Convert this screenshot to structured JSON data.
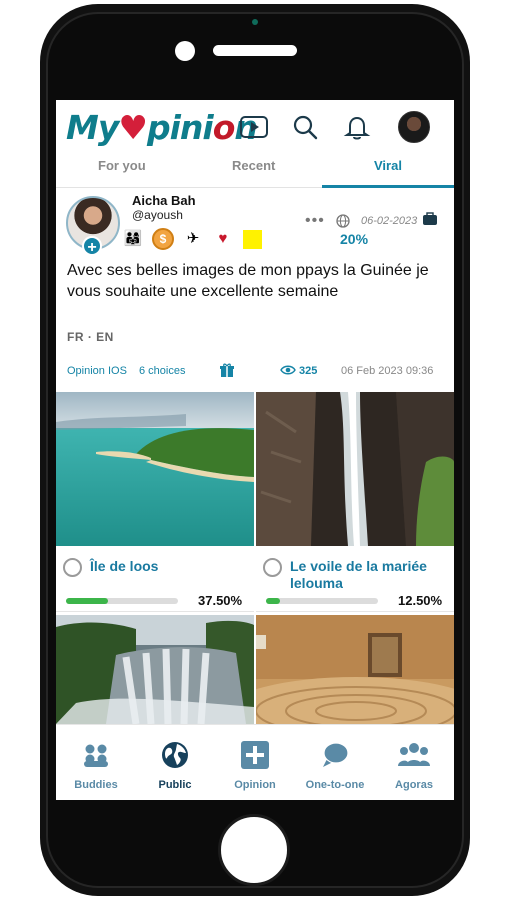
{
  "app": {
    "logo_text_left": "My",
    "logo_heart": "♥",
    "logo_text_right": "pini",
    "logo_text_end": "n",
    "colors": {
      "accent": "#1584a6",
      "brand_teal": "#0f7d8c",
      "heart_red": "#d41f3a",
      "progress_green": "#3cb54a"
    }
  },
  "header_icons": [
    "video-play-icon",
    "search-icon",
    "bell-icon",
    "user-avatar"
  ],
  "tabs": [
    {
      "label": "For you",
      "active": false
    },
    {
      "label": "Recent",
      "active": false
    },
    {
      "label": "Viral",
      "active": true
    }
  ],
  "post": {
    "author_name": "Aicha Bah",
    "author_handle": "@ayoush",
    "more": "•••",
    "date": "06-02-2023",
    "badges_percent": "20%",
    "text": "Avec ses belles images de mon ppays la Guinée je vous souhaite une excellente semaine",
    "langs": "FR  ·  EN",
    "source": "Opinion IOS",
    "choices_count": "6 choices",
    "views": "325",
    "datetime": "06 Feb 2023 09:36"
  },
  "choices": [
    {
      "label": "Île de loos",
      "percent": "37.50%",
      "fraction": 0.375,
      "selected": false
    },
    {
      "label": "Le voile de la mariée lelouma",
      "percent": "12.50%",
      "fraction": 0.125,
      "selected": false
    },
    {
      "label": "",
      "percent": "",
      "selected": false
    },
    {
      "label": "",
      "percent": "",
      "selected": false
    }
  ],
  "bottom_nav": [
    {
      "label": "Buddies",
      "icon": "buddies-icon",
      "active": false
    },
    {
      "label": "Public",
      "icon": "globe-icon",
      "active": true
    },
    {
      "label": "Opinion",
      "icon": "plus-square-icon",
      "active": false
    },
    {
      "label": "One-to-one",
      "icon": "chat-bubbles-icon",
      "active": false
    },
    {
      "label": "Agoras",
      "icon": "group-icon",
      "active": false
    }
  ]
}
